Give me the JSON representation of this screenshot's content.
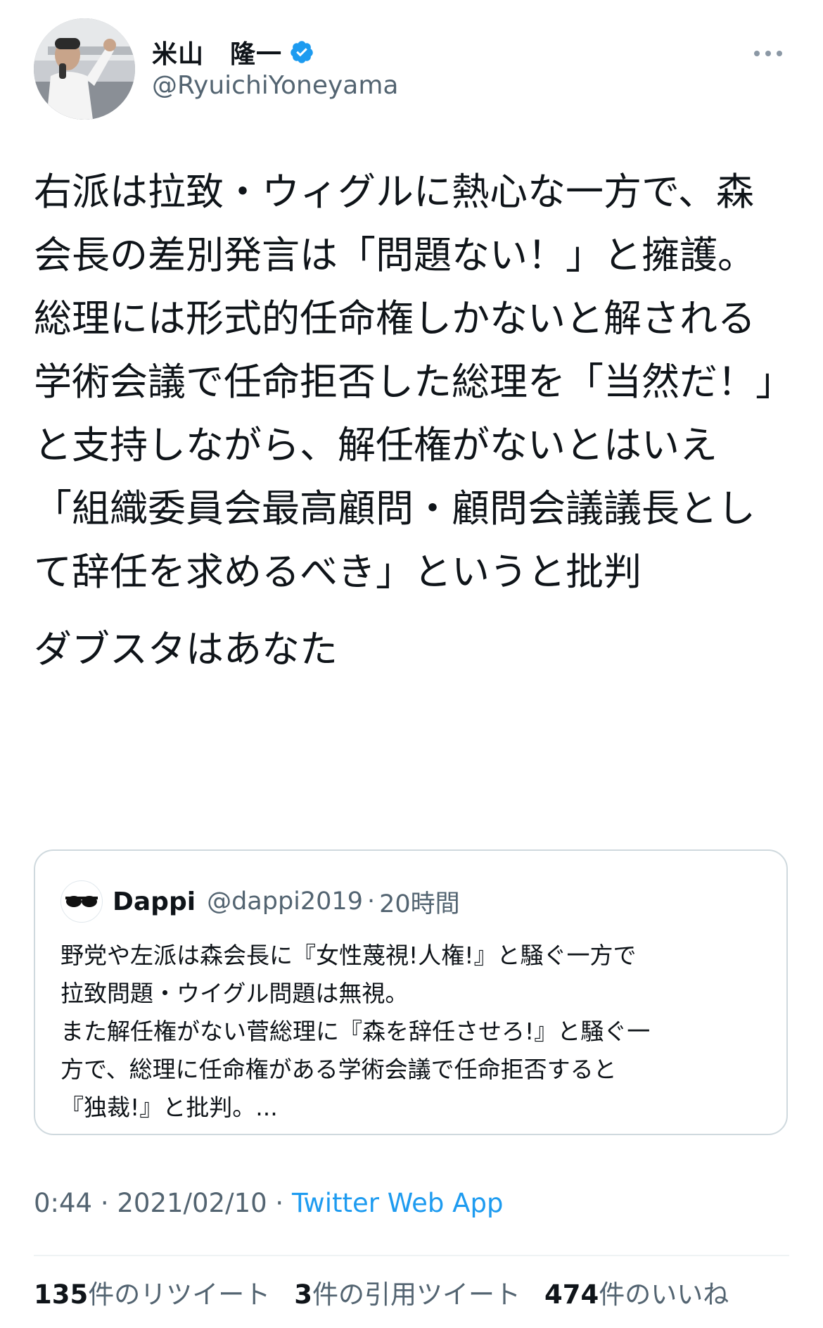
{
  "author": {
    "display_name": "米山　隆一",
    "handle": "@RyuichiYoneyama",
    "verified": true,
    "avatar": "profile-photo"
  },
  "icons": {
    "more": "more-horizontal-icon",
    "verified": "verified-badge-icon",
    "verified_color": "#1d9bf0"
  },
  "tweet": {
    "paragraphs": [
      "右派は拉致・ウィグルに熱心な一方で、森会長の差別発言は「問題ない！」と擁護。\n総理には形式的任命権しかないと解される学術会議で任命拒否した総理を「当然だ！」と支持しながら、解任権がないとはいえ「組織委員会最高顧問・顧問会議議長として辞任を求めるべき」というと批判",
      "ダブスタはあなた"
    ]
  },
  "quoted_tweet": {
    "avatar_label": "Dappi",
    "name": "Dappi",
    "handle": "@dappi2019",
    "separator": "·",
    "time": "20時間",
    "lines": [
      "野党や左派は森会長に『女性蔑視!人権!』と騒ぐ一方で",
      "拉致問題・ウイグル問題は無視。",
      "また解任権がない菅総理に『森を辞任させろ!』と騒ぐ一",
      "方で、総理に任命権がある学術会議で任命拒否すると",
      "『独裁!』と批判。..."
    ]
  },
  "meta": {
    "time": "0:44",
    "separator1": " · ",
    "date": "2021/02/10",
    "separator2": " · ",
    "source": "Twitter Web App"
  },
  "stats": {
    "retweets_count": "135",
    "retweets_label": "件のリツイート",
    "quotes_count": "3",
    "quotes_label": "件の引用ツイート",
    "likes_count": "474",
    "likes_label": "件のいいね"
  }
}
